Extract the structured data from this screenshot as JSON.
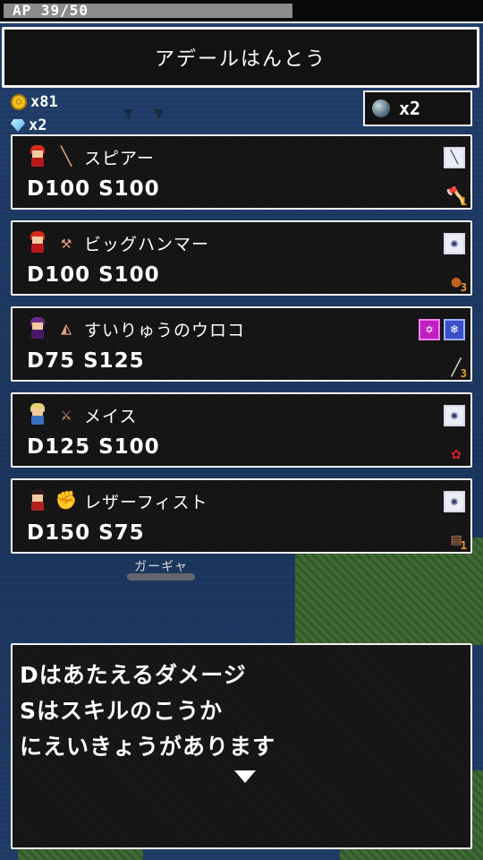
{
  "ap": {
    "label": "AP 39/50",
    "current": 39,
    "max": 50
  },
  "title": "アデールはんとう",
  "currency": {
    "coins": "x81",
    "gems": "x2",
    "stones": "x2"
  },
  "weapons": [
    {
      "name": "スピアー",
      "stats": "D100 S100",
      "char": "red-hair",
      "item_icon": "spear-icon",
      "types": [
        "spear"
      ],
      "material": {
        "icon": "axe-icon",
        "count": "1"
      }
    },
    {
      "name": "ビッグハンマー",
      "stats": "D100 S100",
      "char": "red-hair",
      "item_icon": "hammer-icon",
      "types": [
        "blunt"
      ],
      "material": {
        "icon": "ore-icon",
        "count": "3"
      }
    },
    {
      "name": "すいりゅうのウロコ",
      "stats": "D75 S125",
      "char": "witch",
      "item_icon": "magic-scale-icon",
      "types": [
        "magic",
        "ice"
      ],
      "material": {
        "icon": "bone-icon",
        "count": "3"
      }
    },
    {
      "name": "メイス",
      "stats": "D125 S100",
      "char": "blonde",
      "item_icon": "mace-icon",
      "types": [
        "blunt"
      ],
      "material": {
        "icon": "flower-icon",
        "count": ""
      }
    },
    {
      "name": "レザーフィスト",
      "stats": "D150 S75",
      "char": "dark-hair",
      "item_icon": "fist-icon",
      "types": [
        "blunt"
      ],
      "material": {
        "icon": "hide-icon",
        "count": "1"
      }
    }
  ],
  "map": {
    "town_label": "ガーギャ"
  },
  "message": {
    "lines": [
      "Dはあたえるダメージ",
      "Sはスキルのこうか",
      "にえいきょうがあります"
    ]
  },
  "colors": {
    "panel": "#131313",
    "border": "#f2f2f2",
    "magic": "#c020c0",
    "ice": "#3a50c8"
  }
}
